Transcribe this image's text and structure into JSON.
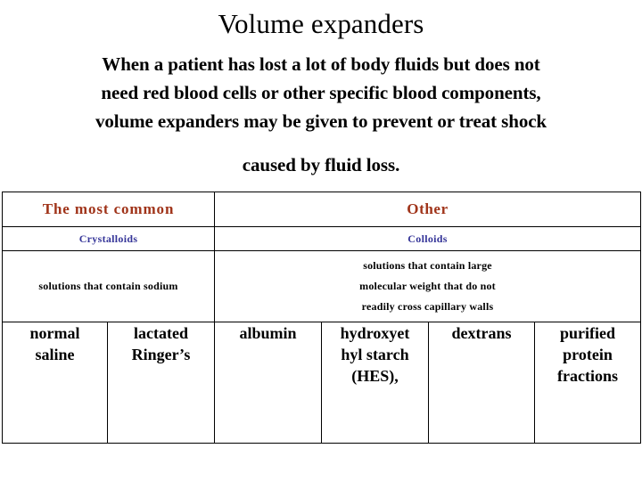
{
  "slide": {
    "title": "Volume expanders",
    "body": {
      "lines": [
        "When a patient has lost a lot of body fluids but does not",
        "need red blood cells or other specific blood components,",
        "volume expanders may be given to prevent or treat shock"
      ],
      "last_line": "caused by fluid loss."
    }
  },
  "colors": {
    "header_accent": "#a0341a",
    "subheader_accent": "#363699",
    "text": "#000000",
    "background": "#ffffff",
    "border": "#000000"
  },
  "table": {
    "header_row": {
      "left": "The most common",
      "right": "Other"
    },
    "subheader_row": {
      "left": "Crystalloids",
      "right": "Colloids"
    },
    "description_row": {
      "left": "solutions that contain sodium",
      "right_lines": [
        "solutions that contain large",
        "molecular weight  that do not",
        "readily cross capillary walls"
      ]
    },
    "items_row": [
      {
        "lines": [
          "normal",
          "saline"
        ]
      },
      {
        "lines": [
          "lactated",
          "Ringer’s"
        ]
      },
      {
        "lines": [
          "albumin"
        ]
      },
      {
        "lines": [
          "hydroxyet",
          "hyl starch",
          "(HES),"
        ]
      },
      {
        "lines": [
          "dextrans"
        ]
      },
      {
        "lines": [
          "purified",
          "protein",
          "fractions"
        ]
      }
    ]
  }
}
